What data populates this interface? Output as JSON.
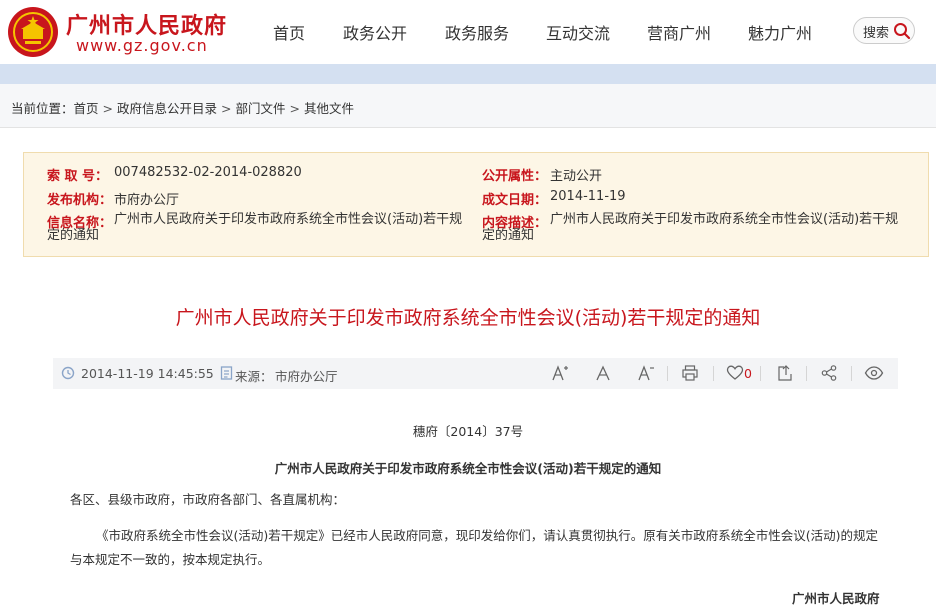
{
  "header": {
    "site_title": "广州市人民政府",
    "site_url": "www.gz.gov.cn",
    "nav": [
      "首页",
      "政务公开",
      "政务服务",
      "互动交流",
      "营商广州",
      "魅力广州"
    ],
    "search_label": "搜索"
  },
  "breadcrumb": {
    "prefix": "当前位置：",
    "items": [
      "首页",
      "政府信息公开目录",
      "部门文件",
      "其他文件"
    ],
    "separator": ">"
  },
  "meta": {
    "index_label": "索 取 号：",
    "index_value": "007482532-02-2014-028820",
    "open_label": "公开属性：",
    "open_value": "主动公开",
    "publisher_label": "发布机构：",
    "publisher_value": "市府办公厅",
    "date_label": "成文日期：",
    "date_value": "2014-11-19",
    "name_label": "信息名称：",
    "name_value": "广州市人民政府关于印发市政府系统全市性会议(活动)若干规定的通知",
    "desc_label": "内容描述：",
    "desc_value": "广州市人民政府关于印发市政府系统全市性会议(活动)若干规定的通知"
  },
  "article": {
    "title": "广州市人民政府关于印发市政府系统全市性会议(活动)若干规定的通知",
    "datetime": "2014-11-19 14:45:55",
    "source_label": "来源：",
    "source_value": "市府办公厅",
    "like_count": "0",
    "doc_number": "穗府〔2014〕37号",
    "doc_title": "广州市人民政府关于印发市政府系统全市性会议(活动)若干规定的通知",
    "salutation": "各区、县级市政府，市政府各部门、各直属机构：",
    "paragraph": "《市政府系统全市性会议(活动)若干规定》已经市人民政府同意，现印发给你们，请认真贯彻执行。原有关市政府系统全市性会议(活动)的规定与本规定不一致的，按本规定执行。",
    "signature": "广州市人民政府"
  },
  "colors": {
    "brand_red": "#c8161d",
    "meta_bg": "#fdf6e6",
    "band_blue": "#d4e0f1"
  }
}
